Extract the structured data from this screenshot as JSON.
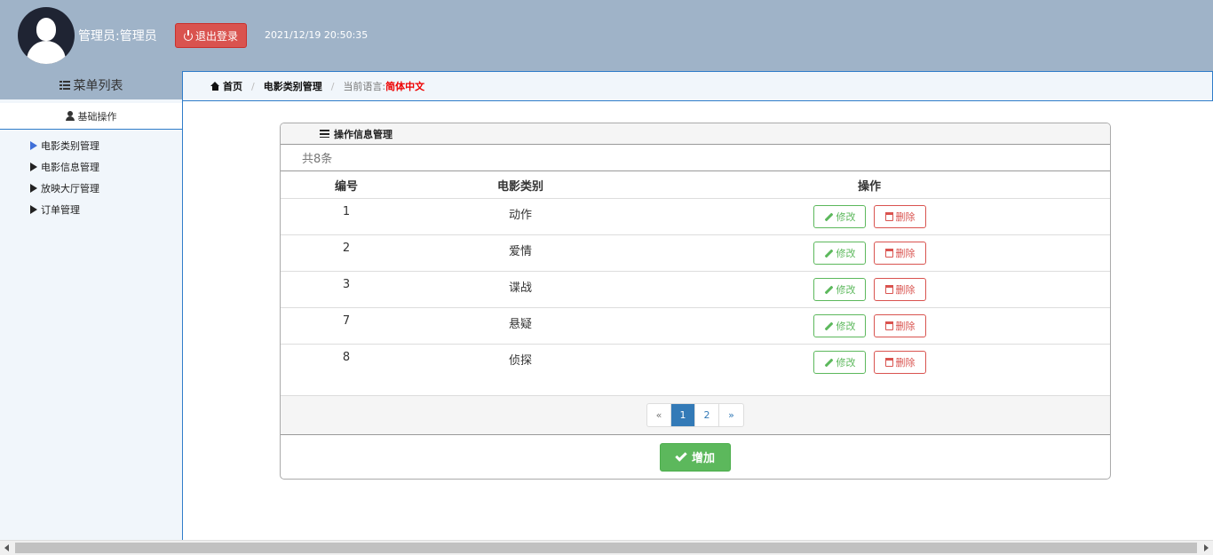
{
  "header": {
    "user_label": "管理员:管理员",
    "logout_label": "退出登录",
    "datetime": "2021/12/19 20:50:35"
  },
  "sidebar": {
    "menu_title": "菜单列表",
    "section_title": "基础操作",
    "items": [
      {
        "label": "电影类别管理",
        "active": true
      },
      {
        "label": "电影信息管理",
        "active": false
      },
      {
        "label": "放映大厅管理",
        "active": false
      },
      {
        "label": "订单管理",
        "active": false
      }
    ]
  },
  "breadcrumb": {
    "home": "首页",
    "current": "电影类别管理",
    "lang_label": "当前语言:",
    "lang_value": "简体中文"
  },
  "panel": {
    "title": "操作信息管理",
    "count_text": "共8条",
    "columns": {
      "id": "编号",
      "category": "电影类别",
      "ops": "操作"
    },
    "rows": [
      {
        "id": "1",
        "category": "动作"
      },
      {
        "id": "2",
        "category": "爱情"
      },
      {
        "id": "3",
        "category": "谍战"
      },
      {
        "id": "7",
        "category": "悬疑"
      },
      {
        "id": "8",
        "category": "侦探"
      }
    ],
    "edit_label": "修改",
    "delete_label": "删除",
    "pager": {
      "prev": "«",
      "pages": [
        "1",
        "2"
      ],
      "next": "»",
      "current": "1"
    },
    "add_label": "增加"
  },
  "colors": {
    "header_bg": "#9fb3c8",
    "logout_red": "#d9534f",
    "success_green": "#5cb85c",
    "primary_blue": "#337ab7",
    "accent_border": "#2f7cc9"
  }
}
